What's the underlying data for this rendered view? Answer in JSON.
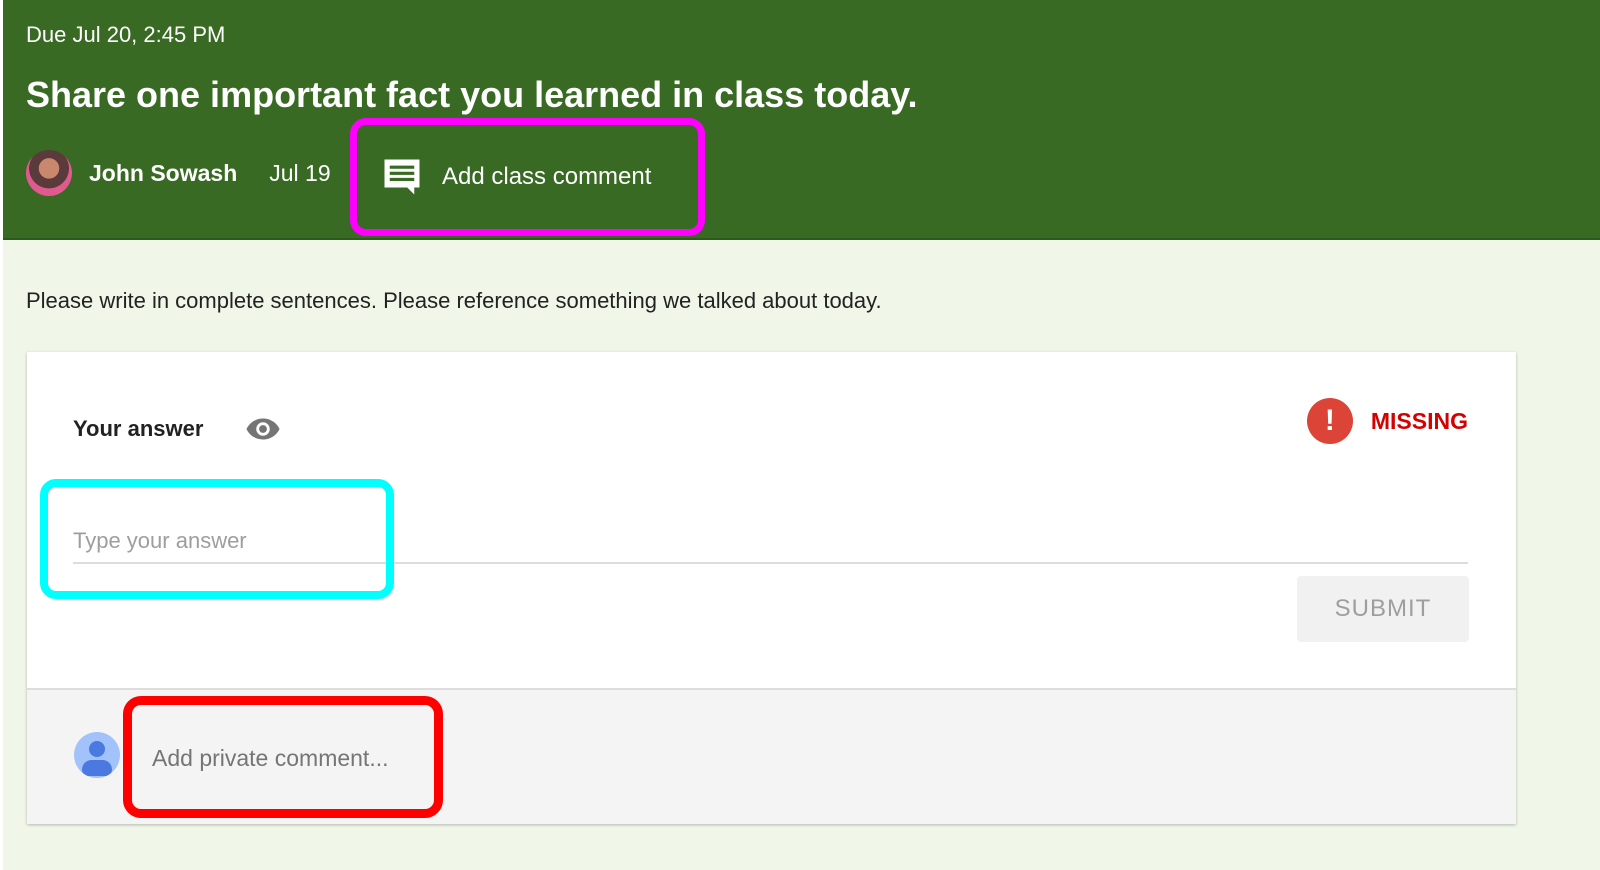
{
  "header": {
    "due": "Due Jul 20, 2:45 PM",
    "title": "Share one important fact you learned in class today.",
    "author": "John Sowash",
    "posted_date": "Jul 19",
    "class_comment_label": "Add class comment",
    "background_color": "#386a23"
  },
  "instructions": "Please write in complete sentences. Please reference something we talked about today.",
  "answer_card": {
    "label": "Your answer",
    "status": "MISSING",
    "status_icon": "!",
    "status_color": "#d50000",
    "answer_placeholder": "Type your answer",
    "answer_value": "",
    "submit_label": "SUBMIT"
  },
  "private_comment": {
    "placeholder": "Add private comment..."
  },
  "annotations": {
    "class_comment_highlight": "#ff00ff",
    "answer_highlight": "#00ffff",
    "private_comment_highlight": "#ff0000"
  }
}
